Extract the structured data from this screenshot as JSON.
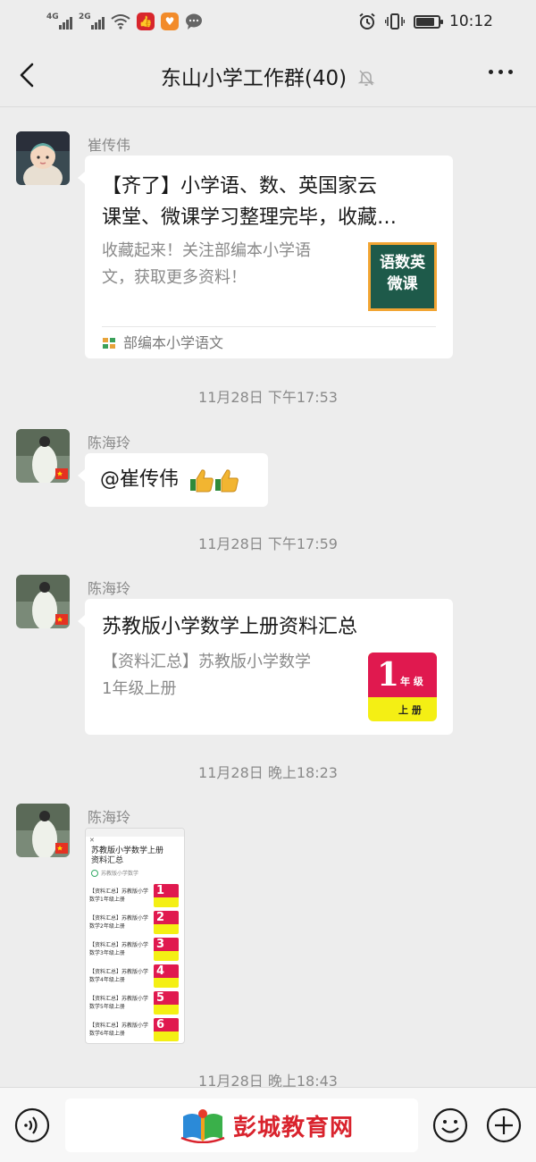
{
  "status_bar": {
    "network1": "4G",
    "network2": "2G",
    "time": "10:12",
    "battery_level": 0.75
  },
  "nav": {
    "title": "东山小学工作群(40)"
  },
  "messages": [
    {
      "sender": "崔传伟",
      "card_title": "【齐了】小学语、数、英国家云课堂、微课学习整理完毕，收藏…",
      "card_title_line1": "【齐了】小学语、数、英国家云",
      "card_title_line2": "课堂、微课学习整理完毕，收藏…",
      "card_desc_line1": "收藏起来！关注部编本小学语",
      "card_desc_line2": "文，获取更多资料！",
      "thumb_line1": "语数英",
      "thumb_line2": "微课",
      "source": "部编本小学语文"
    },
    {
      "time": "11月28日 下午17:53"
    },
    {
      "sender": "陈海玲",
      "text": "@崔传伟"
    },
    {
      "time": "11月28日 下午17:59"
    },
    {
      "sender": "陈海玲",
      "card_title": "苏教版小学数学上册资料汇总",
      "card_desc_line1": "【资料汇总】苏教版小学数学",
      "card_desc_line2": "1年级上册",
      "thumb_num": "1",
      "thumb_grade": "年 级",
      "thumb_vol": "上 册"
    },
    {
      "time": "11月28日 晚上18:23"
    },
    {
      "sender": "陈海玲",
      "shot_title": "苏教版小学数学上册资料汇总",
      "shot_source": "苏教版小学数学",
      "shot_rows": [
        {
          "l1": "【资料汇总】苏教版小学",
          "l2": "数学1年级上册",
          "num": "1"
        },
        {
          "l1": "【资料汇总】苏教版小学",
          "l2": "数学2年级上册",
          "num": "2"
        },
        {
          "l1": "【资料汇总】苏教版小学",
          "l2": "数学3年级上册",
          "num": "3"
        },
        {
          "l1": "【资料汇总】苏教版小学",
          "l2": "数学4年级上册",
          "num": "4"
        },
        {
          "l1": "【资料汇总】苏教版小学",
          "l2": "数学5年级上册",
          "num": "5"
        },
        {
          "l1": "【资料汇总】苏教版小学",
          "l2": "数学6年级上册",
          "num": "6"
        }
      ]
    },
    {
      "time": "11月28日 晚上18:43"
    }
  ],
  "bottom": {
    "brand": "彭城教育网"
  },
  "colors": {
    "background": "#ededed",
    "bubble": "#ffffff",
    "brand_red": "#d9232d",
    "thumb_green": "#1e5a4a",
    "thumb_yellow": "#f4ef14",
    "thumb_red": "#e0194f"
  }
}
